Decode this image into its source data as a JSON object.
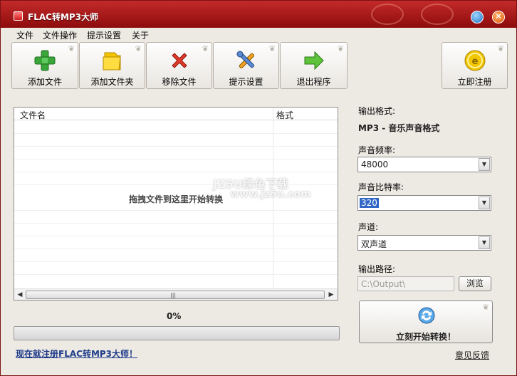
{
  "window": {
    "title": "FLAC转MP3大师"
  },
  "menu": [
    "文件",
    "文件操作",
    "提示设置",
    "关于"
  ],
  "toolbar": [
    {
      "label": "添加文件",
      "icon": "add-plus-icon"
    },
    {
      "label": "添加文件夹",
      "icon": "folder-icon"
    },
    {
      "label": "移除文件",
      "icon": "remove-x-icon"
    },
    {
      "label": "提示设置",
      "icon": "tools-icon"
    },
    {
      "label": "退出程序",
      "icon": "exit-arrow-icon"
    },
    {
      "label": "立即注册",
      "icon": "register-coin-icon"
    }
  ],
  "filelist": {
    "col_name": "文件名",
    "col_format": "格式",
    "hint": "拖拽文件到这里开始转换"
  },
  "progress": {
    "percent_text": "0%",
    "value": 0
  },
  "links": {
    "register": "现在就注册FLAC转MP3大师！",
    "feedback": "意见反馈"
  },
  "settings": {
    "output_format_label": "输出格式:",
    "output_format_value": "MP3 - 音乐声音格式",
    "sample_rate_label": "声音频率:",
    "sample_rate_value": "48000",
    "bitrate_label": "声音比特率:",
    "bitrate_value": "320",
    "channel_label": "声道:",
    "channel_value": "双声道",
    "output_path_label": "输出路径:",
    "output_path_value": "C:\\Output\\",
    "browse_label": "浏览",
    "convert_label": "立刻开始转换！"
  },
  "watermark": {
    "line1": "JZ5U绿色下载",
    "line2": "www.jz5u.com"
  },
  "colors": {
    "titlebar": "#a91818",
    "accent": "#3167c5",
    "link": "#1e3c8a"
  }
}
